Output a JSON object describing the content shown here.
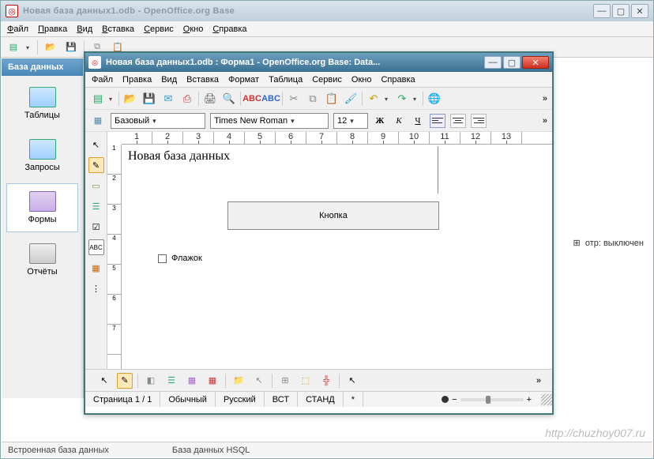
{
  "outer": {
    "title": "Новая база данных1.odb - OpenOffice.org Base",
    "menu": [
      "Файл",
      "Правка",
      "Вид",
      "Вставка",
      "Сервис",
      "Окно",
      "Справка"
    ]
  },
  "sidebar": {
    "header": "База данных",
    "items": [
      {
        "label": "Таблицы"
      },
      {
        "label": "Запросы"
      },
      {
        "label": "Формы"
      },
      {
        "label": "Отчёты"
      }
    ]
  },
  "right_hint": "отр: выключен",
  "status": {
    "left": "Встроенная база данных",
    "mid": "База данных HSQL"
  },
  "watermark": "http://chuzhoy007.ru",
  "inner": {
    "title": "Новая база данных1.odb : Форма1 - OpenOffice.org Base: Data...",
    "menu": [
      "Файл",
      "Правка",
      "Вид",
      "Вставка",
      "Формат",
      "Таблица",
      "Сервис",
      "Окно",
      "Справка"
    ],
    "style_combo": "Базовый",
    "font_combo": "Times New Roman",
    "size_combo": "12",
    "fmt": {
      "bold": "Ж",
      "italic": "К",
      "underline": "Ч"
    },
    "doc_title": "Новая база данных",
    "form_button": "Кнопка",
    "form_checkbox": "Флажок",
    "ruler_marks": [
      "1",
      "2",
      "3",
      "4",
      "5",
      "6",
      "7",
      "8",
      "9",
      "10",
      "11",
      "12",
      "13"
    ],
    "vruler_marks": [
      "1",
      "2",
      "3",
      "4",
      "5",
      "6",
      "7"
    ],
    "status": {
      "page": "Страница 1 / 1",
      "style": "Обычный",
      "lang": "Русский",
      "ins": "ВСТ",
      "std": "СТАНД",
      "mark": "*"
    }
  }
}
